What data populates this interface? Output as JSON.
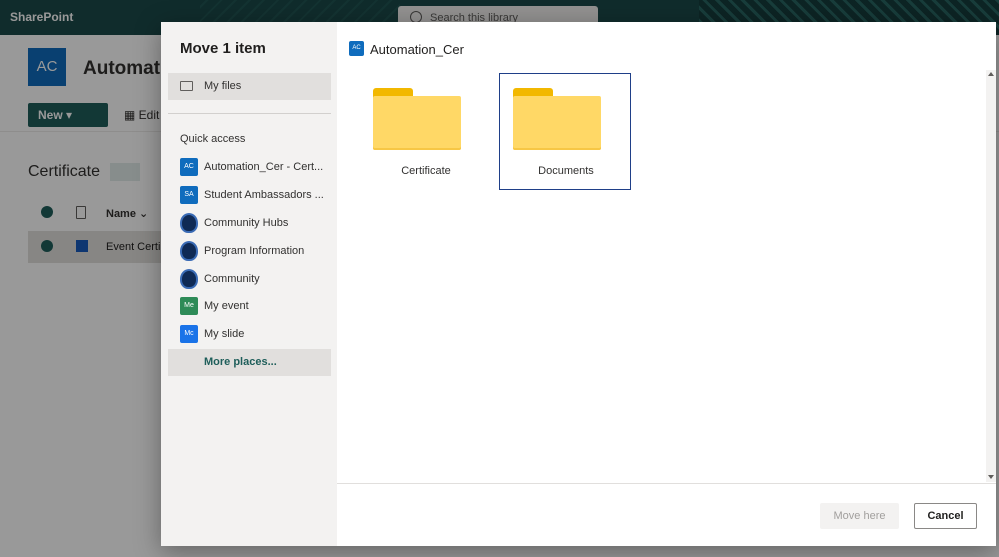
{
  "background": {
    "brand": "SharePoint",
    "search_placeholder": "Search this library",
    "site_logo": "AC",
    "site_title": "Automati",
    "new_label": "New",
    "edit_label": "Edit",
    "library_title": "Certificate",
    "name_column": "Name",
    "row_file": "Event Certi"
  },
  "dialog": {
    "title": "Move 1 item",
    "my_files": "My files",
    "quick_access_label": "Quick access",
    "quick_access": [
      {
        "label": "Automation_Cer - Cert...",
        "icon": "AC",
        "color": "#0f6cbd"
      },
      {
        "label": "Student Ambassadors ...",
        "icon": "SA",
        "color": "#0f6cbd"
      },
      {
        "label": "Community Hubs",
        "icon": "shield-icon"
      },
      {
        "label": "Program Information",
        "icon": "shield-icon"
      },
      {
        "label": "Community",
        "icon": "shield-icon"
      },
      {
        "label": "My event",
        "icon": "Me",
        "color": "#2e8b57"
      },
      {
        "label": "My slide",
        "icon": "Mc",
        "color": "#1a73e8"
      }
    ],
    "more_places": "More places...",
    "breadcrumb_icon": "AC",
    "breadcrumb": "Automation_Cer",
    "folders": [
      {
        "name": "Certificate",
        "selected": false
      },
      {
        "name": "Documents",
        "selected": true
      }
    ],
    "move_here": "Move here",
    "cancel": "Cancel"
  },
  "colors": {
    "accent": "#1e5e5a",
    "site_blue": "#0f6cbd",
    "folder_yellow": "#ffd866",
    "selection_border": "#1f3f88"
  }
}
